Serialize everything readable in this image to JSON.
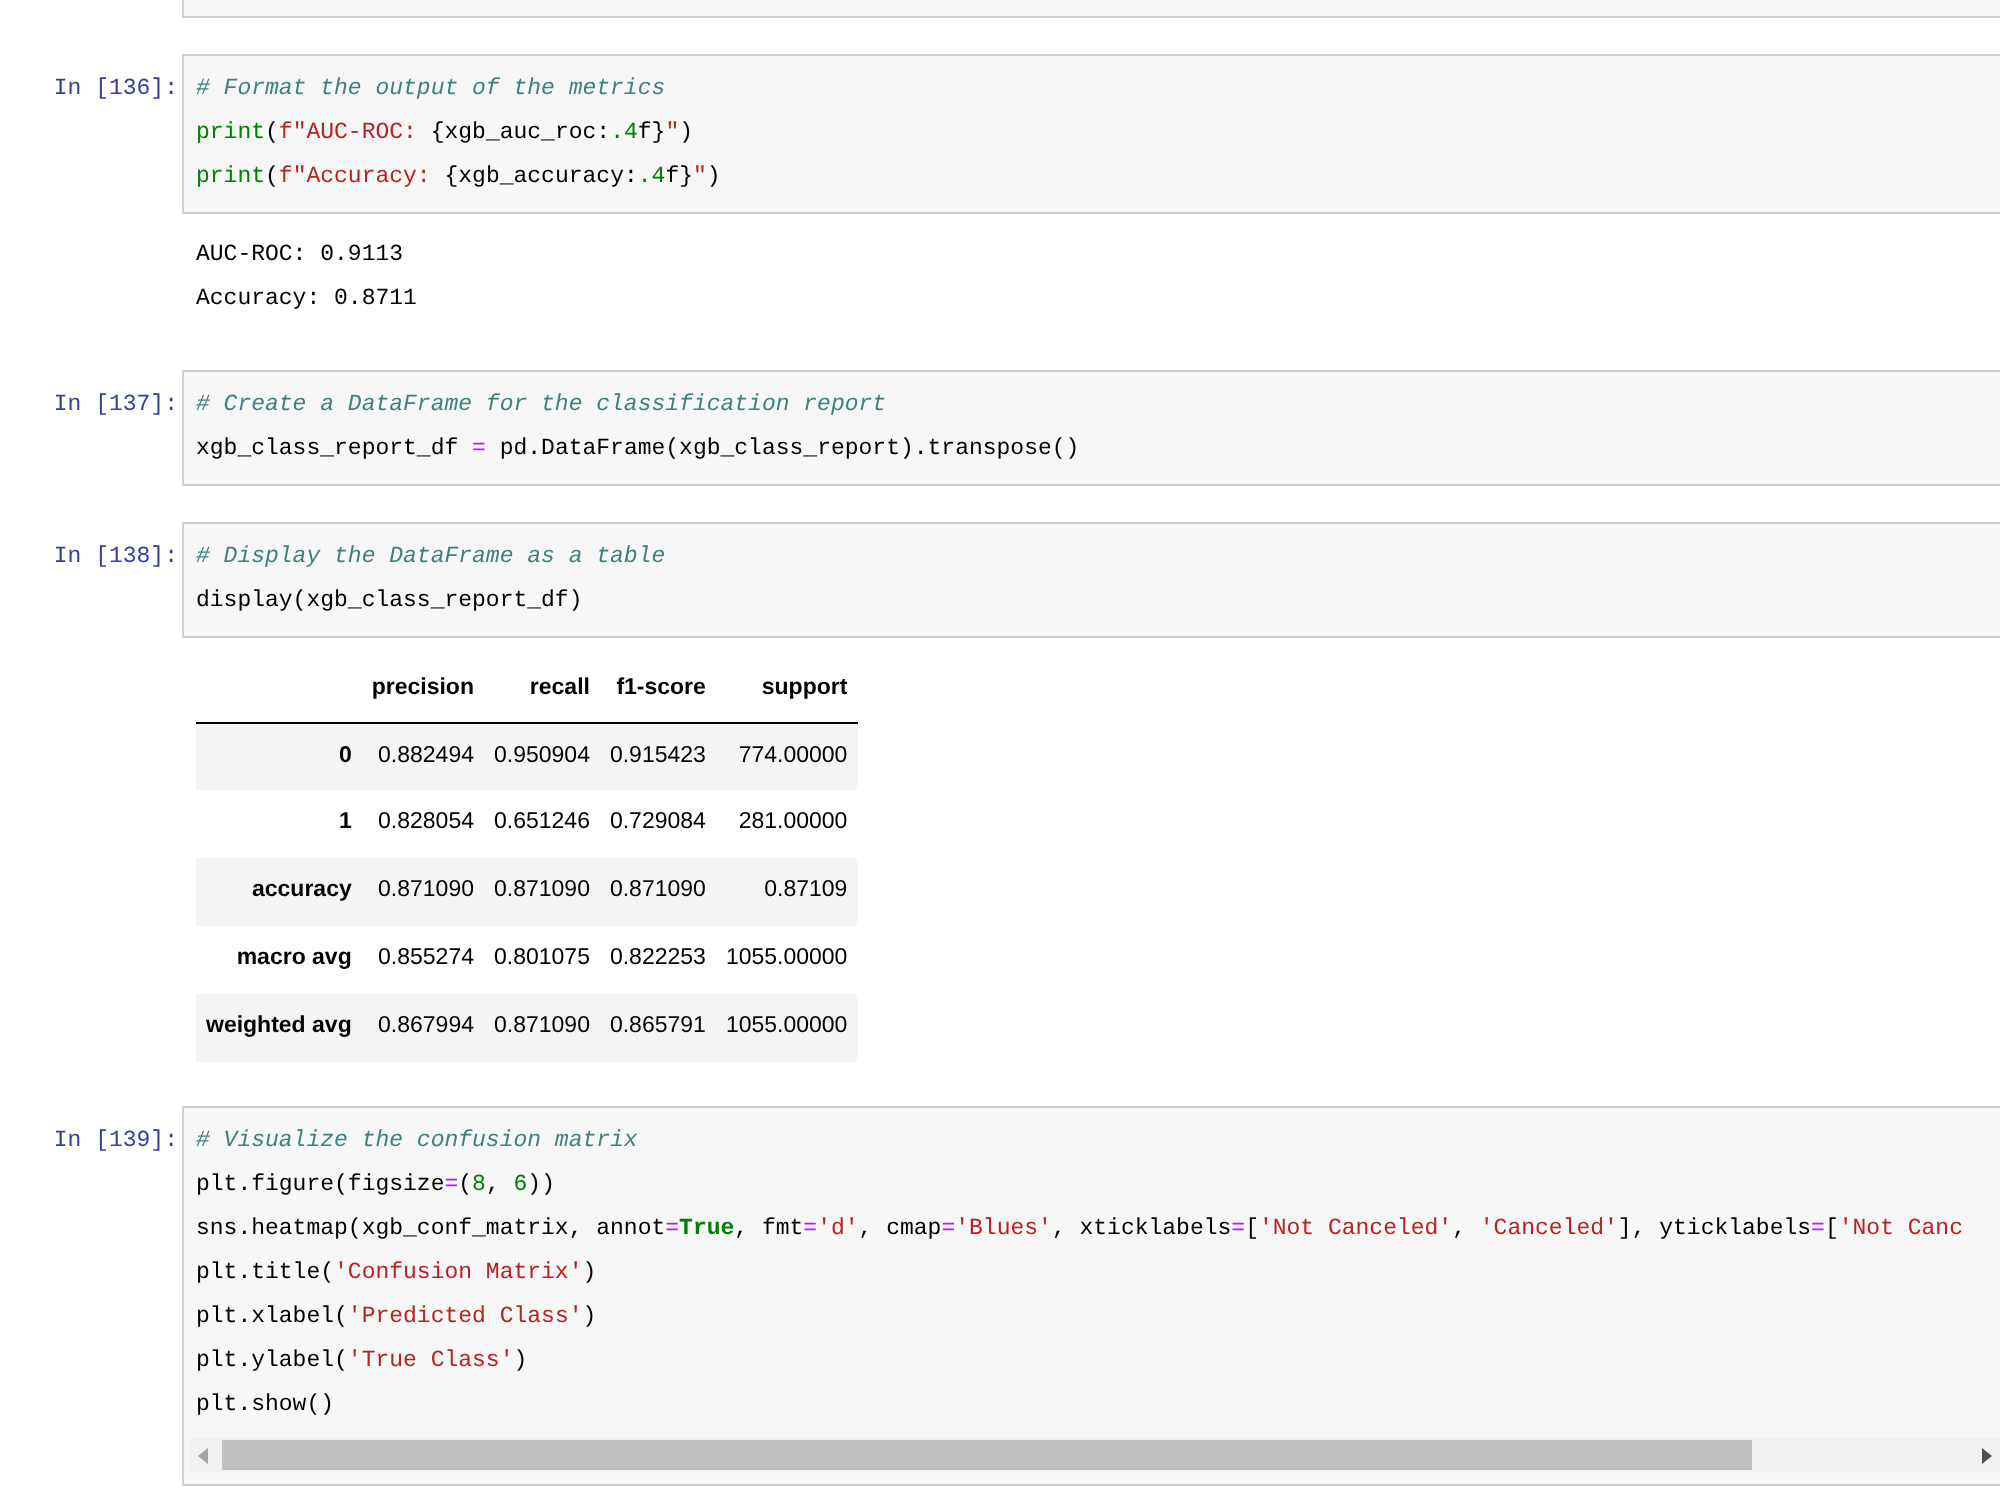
{
  "cells": [
    {
      "prompt": "In [136]:",
      "scrollable": false,
      "lines": [
        [
          {
            "kind": "comment",
            "text": "# Format the output of the metrics"
          }
        ],
        [
          {
            "kind": "builtin",
            "text": "print"
          },
          {
            "kind": "plain",
            "text": "("
          },
          {
            "kind": "string",
            "text": "f\"AUC-ROC: "
          },
          {
            "kind": "plain",
            "text": "{xgb_auc_roc:"
          },
          {
            "kind": "number",
            "text": ".4"
          },
          {
            "kind": "plain",
            "text": "f}"
          },
          {
            "kind": "string",
            "text": "\""
          },
          {
            "kind": "plain",
            "text": ")"
          }
        ],
        [
          {
            "kind": "builtin",
            "text": "print"
          },
          {
            "kind": "plain",
            "text": "("
          },
          {
            "kind": "string",
            "text": "f\"Accuracy: "
          },
          {
            "kind": "plain",
            "text": "{xgb_accuracy:"
          },
          {
            "kind": "number",
            "text": ".4"
          },
          {
            "kind": "plain",
            "text": "f}"
          },
          {
            "kind": "string",
            "text": "\""
          },
          {
            "kind": "plain",
            "text": ")"
          }
        ]
      ],
      "output": {
        "kind": "stream",
        "lines": [
          "AUC-ROC: 0.9113",
          "Accuracy: 0.8711"
        ]
      }
    },
    {
      "prompt": "In [137]:",
      "scrollable": false,
      "lines": [
        [
          {
            "kind": "comment",
            "text": "# Create a DataFrame for the classification report"
          }
        ],
        [
          {
            "kind": "plain",
            "text": "xgb_class_report_df "
          },
          {
            "kind": "operator",
            "text": "="
          },
          {
            "kind": "plain",
            "text": " pd.DataFrame(xgb_class_report).transpose()"
          }
        ]
      ]
    },
    {
      "prompt": "In [138]:",
      "scrollable": false,
      "lines": [
        [
          {
            "kind": "comment",
            "text": "# Display the DataFrame as a table"
          }
        ],
        [
          {
            "kind": "plain",
            "text": "display(xgb_class_report_df)"
          }
        ]
      ],
      "output": {
        "kind": "table",
        "columns": [
          "precision",
          "recall",
          "f1-score",
          "support"
        ],
        "rows": [
          {
            "index": "0",
            "values": [
              "0.882494",
              "0.950904",
              "0.915423",
              "774.00000"
            ]
          },
          {
            "index": "1",
            "values": [
              "0.828054",
              "0.651246",
              "0.729084",
              "281.00000"
            ]
          },
          {
            "index": "accuracy",
            "values": [
              "0.871090",
              "0.871090",
              "0.871090",
              "0.87109"
            ]
          },
          {
            "index": "macro avg",
            "values": [
              "0.855274",
              "0.801075",
              "0.822253",
              "1055.00000"
            ]
          },
          {
            "index": "weighted avg",
            "values": [
              "0.867994",
              "0.871090",
              "0.865791",
              "1055.00000"
            ]
          }
        ]
      }
    },
    {
      "prompt": "In [139]:",
      "scrollable": true,
      "lines": [
        [
          {
            "kind": "comment",
            "text": "# Visualize the confusion matrix"
          }
        ],
        [
          {
            "kind": "plain",
            "text": "plt.figure(figsize"
          },
          {
            "kind": "operator",
            "text": "="
          },
          {
            "kind": "plain",
            "text": "("
          },
          {
            "kind": "number",
            "text": "8"
          },
          {
            "kind": "plain",
            "text": ", "
          },
          {
            "kind": "number",
            "text": "6"
          },
          {
            "kind": "plain",
            "text": "))"
          }
        ],
        [
          {
            "kind": "plain",
            "text": "sns.heatmap(xgb_conf_matrix, annot"
          },
          {
            "kind": "operator",
            "text": "="
          },
          {
            "kind": "keyword",
            "text": "True"
          },
          {
            "kind": "plain",
            "text": ", fmt"
          },
          {
            "kind": "operator",
            "text": "="
          },
          {
            "kind": "string",
            "text": "'d'"
          },
          {
            "kind": "plain",
            "text": ", cmap"
          },
          {
            "kind": "operator",
            "text": "="
          },
          {
            "kind": "string",
            "text": "'Blues'"
          },
          {
            "kind": "plain",
            "text": ", xticklabels"
          },
          {
            "kind": "operator",
            "text": "="
          },
          {
            "kind": "plain",
            "text": "["
          },
          {
            "kind": "string",
            "text": "'Not Canceled'"
          },
          {
            "kind": "plain",
            "text": ", "
          },
          {
            "kind": "string",
            "text": "'Canceled'"
          },
          {
            "kind": "plain",
            "text": "], yticklabels"
          },
          {
            "kind": "operator",
            "text": "="
          },
          {
            "kind": "plain",
            "text": "["
          },
          {
            "kind": "string",
            "text": "'Not Canc"
          }
        ],
        [
          {
            "kind": "plain",
            "text": "plt.title("
          },
          {
            "kind": "string",
            "text": "'Confusion Matrix'"
          },
          {
            "kind": "plain",
            "text": ")"
          }
        ],
        [
          {
            "kind": "plain",
            "text": "plt.xlabel("
          },
          {
            "kind": "string",
            "text": "'Predicted Class'"
          },
          {
            "kind": "plain",
            "text": ")"
          }
        ],
        [
          {
            "kind": "plain",
            "text": "plt.ylabel("
          },
          {
            "kind": "string",
            "text": "'True Class'"
          },
          {
            "kind": "plain",
            "text": ")"
          }
        ],
        [
          {
            "kind": "plain",
            "text": "plt.show()"
          }
        ]
      ]
    }
  ]
}
